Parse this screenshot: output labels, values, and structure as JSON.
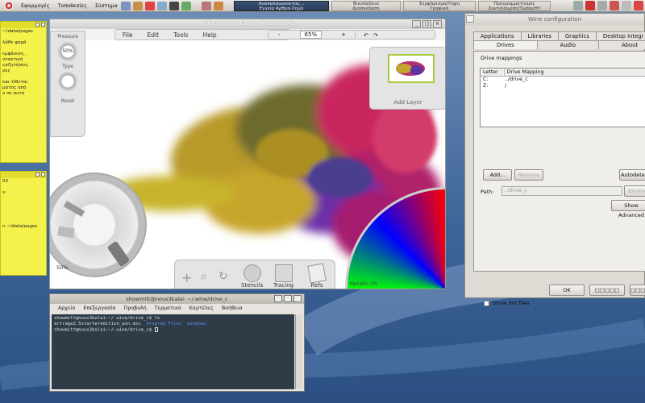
{
  "top_panel": {
    "menus": [
      "Εφαρμογές",
      "Τοποθεσίες",
      "Σύστημα"
    ],
    "tasks": [
      {
        "line1": "Αναπαλαιώνοντας...",
        "line2": "Εγγείρ Αρθρα-Σημα"
      },
      {
        "line1": "Βικιπαίδεια",
        "line2": "Διασκέδαση"
      },
      {
        "line1": "Σερφάρισμα/Λήψη",
        "line2": "Γραφικά"
      },
      {
        "line1": "Προγραμματισμός",
        "line2": "Συντ/ησιμ/ση/ΤώπουΗΥ"
      }
    ]
  },
  "notes": [
    {
      "lines": [
        "~/data/pages",
        "",
        "λάθε φορά",
        "",
        "εμφάνιση ,",
        "ντακτικό",
        "ςαζητήσεις",
        "ρες",
        "",
        "και τίθεται",
        "ματος από",
        "ο σε αυτό"
      ]
    },
    {
      "lines": [
        "03",
        "",
        "s:",
        "",
        "",
        "",
        "",
        "",
        "n ~/data/pages"
      ]
    }
  ],
  "artrage": {
    "title": "ArtRage Starter Edition - A Work Of Art",
    "menu": [
      "File",
      "Edit",
      "Tools",
      "Help"
    ],
    "zoom": "65%",
    "zoom_minus": "-",
    "zoom_plus": "+",
    "pressure_label": "Pressure",
    "pressure_value": "50%",
    "type_label": "Type",
    "reset_label": "Reset",
    "add_layer": "Add Layer",
    "tool_size": "50%",
    "dock": [
      "Stencils",
      "Tracing",
      "Refs"
    ],
    "metallic_label": "Metallic",
    "metallic_value": "0%",
    "window_buttons": [
      "_",
      "□",
      "×"
    ]
  },
  "terminal": {
    "title": "showmitt@nous3kalai: ~/.wine/drive_c",
    "menu": [
      "Αρχείο",
      "Επεξεργασία",
      "Προβολή",
      "Τερματικό",
      "Καρτέλες",
      "Βοήθεια"
    ],
    "line1": "showmitt@nous3kalai:~/.wine/drive_c$ ls",
    "line2_file": "artrage2.5starteredition_win.msi",
    "line2_dir1": "Program Files",
    "line2_dir2": "windows",
    "line3": "showmitt@nous3kalai:~/.wine/drive_c$ "
  },
  "wine": {
    "title": "Wine configuration",
    "tabs_row1": [
      "Applications",
      "Libraries",
      "Graphics",
      "Desktop Integr"
    ],
    "tabs_row2": [
      "Drives",
      "Audio",
      "About"
    ],
    "drive_mappings_label": "Drive mappings",
    "col_letter": "Letter",
    "col_mapping": "Drive Mapping",
    "drives": [
      {
        "letter": "C:",
        "mapping": "../drive_c"
      },
      {
        "letter": "Z:",
        "mapping": "/"
      }
    ],
    "add_button": "Add...",
    "remove_button": "Remove",
    "autodetect_button": "Autodetect",
    "path_label": "Path:",
    "path_value": "../drive_c",
    "browse_button": "Browse",
    "show_advanced_button": "Show Advanced",
    "show_dot_files": "Show dot files",
    "ok_button": "OK",
    "cancel_button": "□□□□□",
    "apply_button": "□□□□□"
  }
}
